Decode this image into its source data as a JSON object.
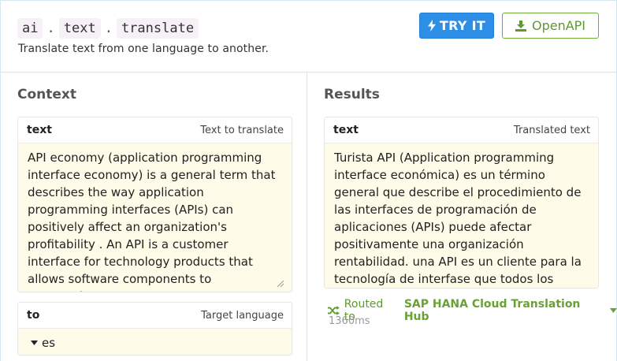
{
  "header": {
    "crumbs": [
      "ai",
      "text",
      "translate"
    ],
    "separator": ".",
    "subtitle": "Translate text from one language to another.",
    "try_label": "TRY IT",
    "openapi_label": "OpenAPI"
  },
  "context": {
    "title": "Context",
    "text_field": {
      "key": "text",
      "hint": "Text to translate",
      "value": "API economy (application programming interface economy) is a general term that describes the way application programming interfaces (APIs) can positively affect an organization's profitability . An API is a customer interface for technology products that allows software components to communicate."
    },
    "to_field": {
      "key": "to",
      "hint": "Target language",
      "value": "es"
    }
  },
  "results": {
    "title": "Results",
    "text_field": {
      "key": "text",
      "hint": "Translated text",
      "value": "Turista API (Application programming interface económica) es un término general que describe el procedimiento de las interfaces de programación de aplicaciones (APIs) puede afectar positivamente una organización rentabilidad. una API es un cliente para la tecnología de interfase que todos los productos"
    },
    "routed_label": "Routed to",
    "provider": "SAP HANA Cloud Translation Hub",
    "timing": "1360ms"
  },
  "colors": {
    "primary": "#2c8ee4",
    "green": "#5e9a2d",
    "field_bg": "#fefbe8",
    "border": "#d6e6ee"
  },
  "icons": {
    "try": "bolt-icon",
    "openapi": "download-icon",
    "select": "caret-down-icon",
    "routed": "shuffle-icon",
    "provider": "caret-down-icon"
  }
}
